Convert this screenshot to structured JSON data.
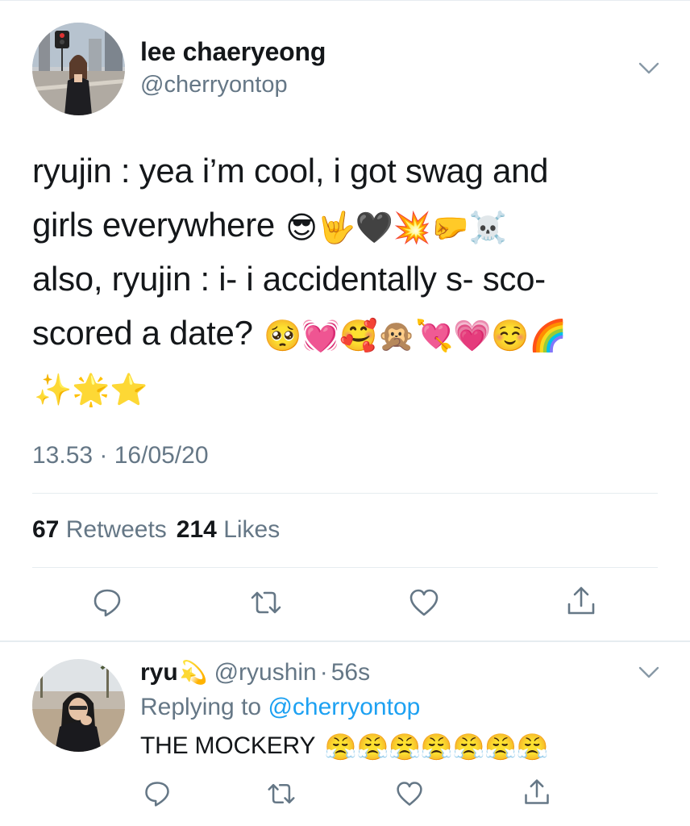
{
  "theme": {
    "text_primary": "#14171a",
    "text_secondary": "#657786",
    "link": "#1da1f2",
    "divider": "#e6ecf0",
    "icon": "#657786"
  },
  "tweet": {
    "author_name": "lee chaeryeong",
    "author_handle": "@cherryontop",
    "avatar_icon": "user-photo-avatar",
    "menu_icon": "chevron-down-icon",
    "lines": [
      {
        "text": "ryujin : yea i’m cool, i got swag and",
        "emoji": ""
      },
      {
        "text": "girls everywhere ",
        "emoji": "😎🤟🖤💥🤛☠️"
      },
      {
        "text": "also, ryujin : i- i accidentally s- sco-",
        "emoji": ""
      },
      {
        "text": "scored a date? ",
        "emoji": "🥺💓🥰🙊💘💗☺️🌈"
      },
      {
        "text": "",
        "emoji": "✨🌟⭐"
      }
    ],
    "timestamp": "13.53 · 16/05/20",
    "retweets_count": "67",
    "retweets_label": "Retweets",
    "likes_count": "214",
    "likes_label": "Likes",
    "actions": [
      "reply-icon",
      "retweet-icon",
      "like-icon",
      "share-icon"
    ]
  },
  "reply": {
    "author_name": "ryu",
    "name_emoji": "💫",
    "author_handle": "@ryushin",
    "separator": "·",
    "time": "56s",
    "replying_prefix": "Replying to",
    "replying_to": "@cherryontop",
    "text": "THE MOCKERY ",
    "emoji": "😤😤😤😤😤😤😤",
    "menu_icon": "chevron-down-icon",
    "actions": [
      "reply-icon",
      "retweet-icon",
      "like-icon",
      "share-icon"
    ]
  }
}
